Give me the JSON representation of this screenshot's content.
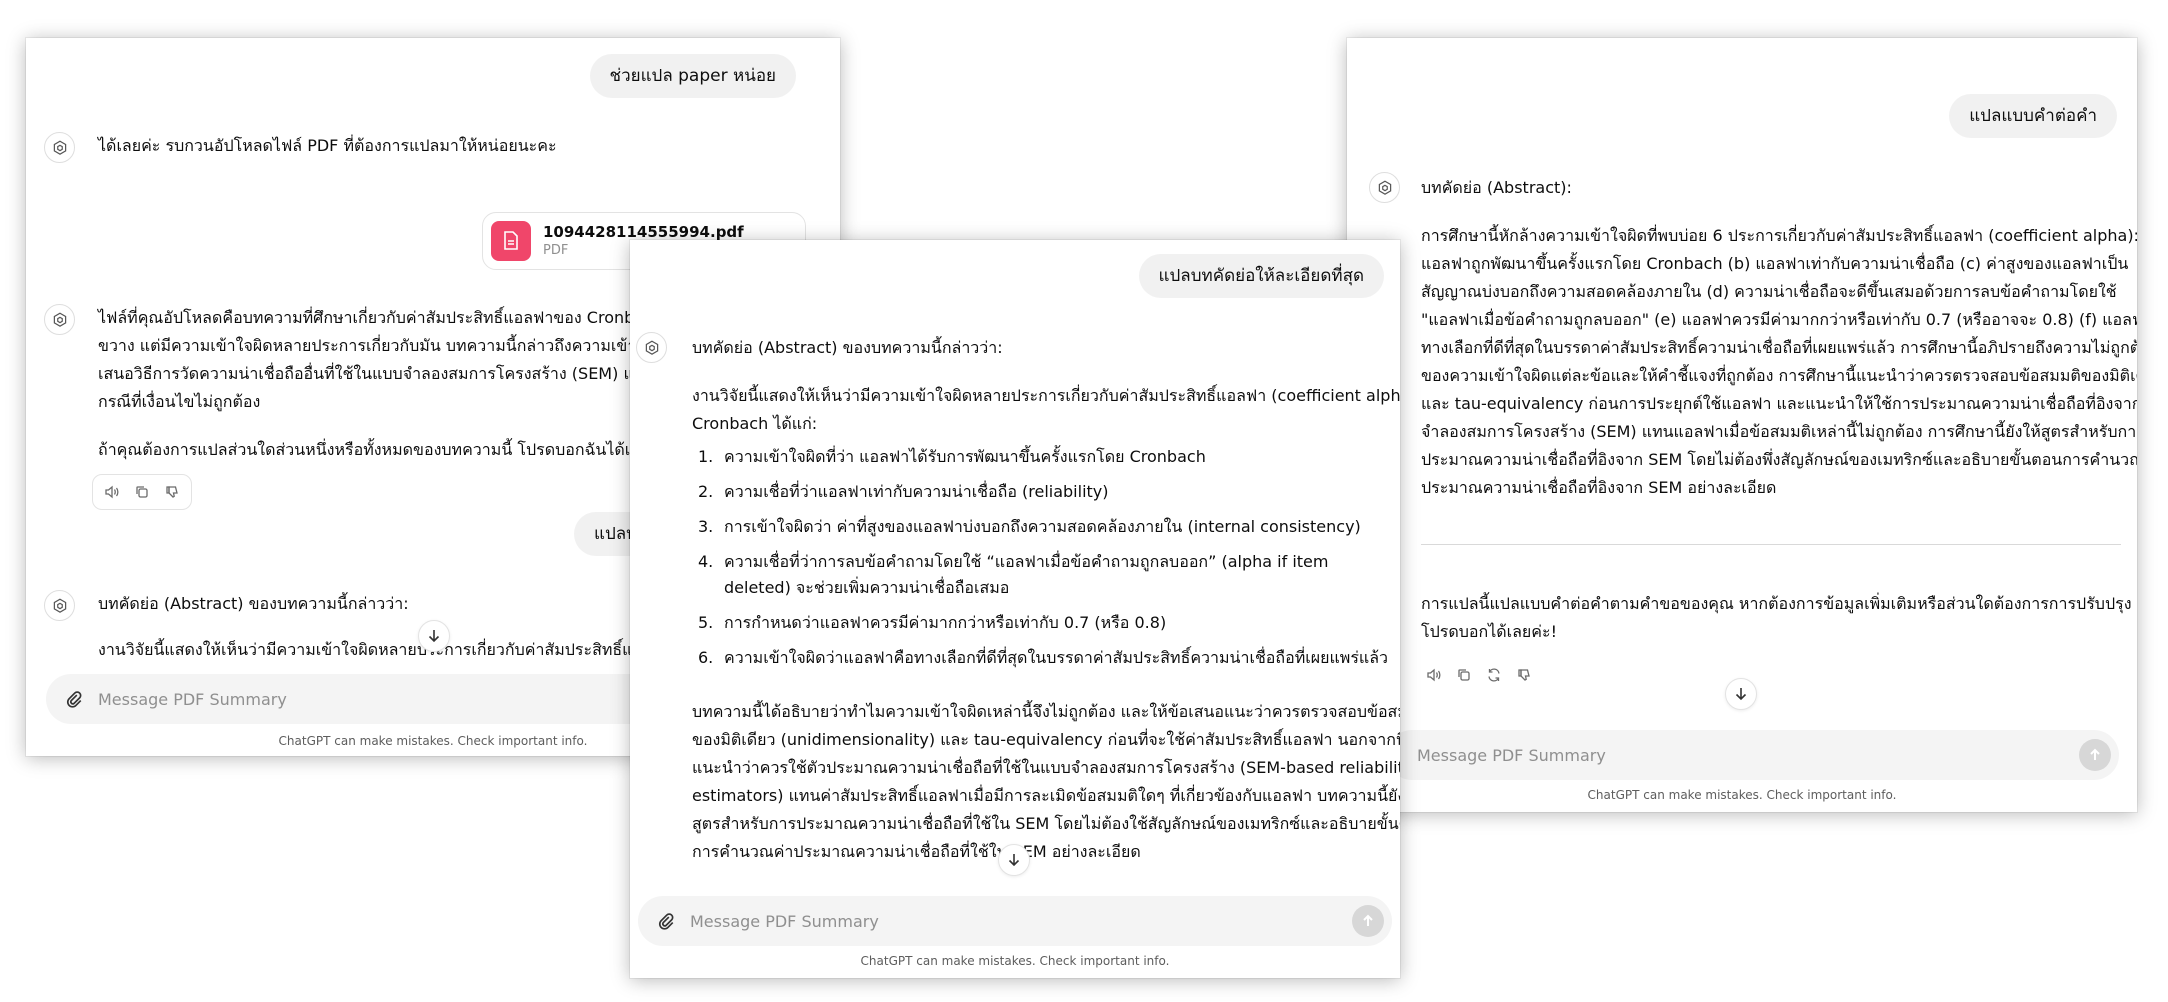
{
  "left_window": {
    "user_msg_1": "ช่วยแปล paper หน่อย",
    "assistant_msg_1": "ได้เลยค่ะ รบกวนอัปโหลดไฟล์ PDF ที่ต้องการแปลมาให้หน่อยนะคะ",
    "file": {
      "name": "1094428114555994.pdf",
      "type": "PDF"
    },
    "assistant_msg_2_lines": [
      "ไฟล์ที่คุณอัปโหลดคือบทความที่ศึกษาเกี่ยวกับค่าสัมประสิทธิ์แอลฟาของ Cronbach",
      "ขวาง แต่มีความเข้าใจผิดหลายประการเกี่ยวกับมัน บทความนี้กล่าวถึงความเข้าใจผิด",
      "เสนอวิธีการวัดความน่าเชื่อถืออื่นที่ใช้ในแบบจำลองสมการโครงสร้าง (SEM) แทนค่า",
      "กรณีที่เงื่อนไขไม่ถูกต้อง"
    ],
    "assistant_msg_3": "ถ้าคุณต้องการแปลส่วนใดส่วนหนึ่งหรือทั้งหมดของบทความนี้ โปรดบอกฉันได้เลยค่ะ",
    "user_msg_2_partial": "แปลบ",
    "assistant_msg_4": "บทคัดย่อ (Abstract) ของบทความนี้กล่าวว่า:",
    "assistant_msg_5_partial": "งานวิจัยนี้แสดงให้เห็นว่ามีความเข้าใจผิดหลายประการเกี่ยวกับค่าสัมประสิทธิ์แอลฟา",
    "composer_placeholder": "Message PDF Summary",
    "disclaimer": "ChatGPT can make mistakes. Check important info."
  },
  "center_window": {
    "user_msg": "แปลบทคัดย่อให้ละเอียดที่สุด",
    "assistant_intro": "บทคัดย่อ (Abstract) ของบทความนี้กล่าวว่า:",
    "para1_lines": [
      "งานวิจัยนี้แสดงให้เห็นว่ามีความเข้าใจผิดหลายประการเกี่ยวกับค่าสัมประสิทธิ์แอลฟา (coefficient alpha) ของ",
      "Cronbach ได้แก่:"
    ],
    "list": [
      {
        "n": "1.",
        "text": "ความเข้าใจผิดที่ว่า แอลฟาได้รับการพัฒนาขึ้นครั้งแรกโดย Cronbach"
      },
      {
        "n": "2.",
        "text": "ความเชื่อที่ว่าแอลฟาเท่ากับความน่าเชื่อถือ (reliability)"
      },
      {
        "n": "3.",
        "text": "การเข้าใจผิดว่า ค่าที่สูงของแอลฟาบ่งบอกถึงความสอดคล้องภายใน (internal consistency)"
      },
      {
        "n": "4.",
        "text": "ความเชื่อที่ว่าการลบข้อคำถามโดยใช้ “แอลฟาเมื่อข้อคำถามถูกลบออก” (alpha if item deleted) จะช่วยเพิ่มความน่าเชื่อถือเสมอ"
      },
      {
        "n": "5.",
        "text": "การกำหนดว่าแอลฟาควรมีค่ามากกว่าหรือเท่ากับ 0.7 (หรือ 0.8)"
      },
      {
        "n": "6.",
        "text": "ความเข้าใจผิดว่าแอลฟาคือทางเลือกที่ดีที่สุดในบรรดาค่าสัมประสิทธิ์ความน่าเชื่อถือที่เผยแพร่แล้ว"
      }
    ],
    "para2_lines": [
      "บทความนี้ได้อธิบายว่าทำไมความเข้าใจผิดเหล่านี้จึงไม่ถูกต้อง และให้ข้อเสนอแนะว่าควรตรวจสอบข้อสมมติ",
      "ของมิติเดียว (unidimensionality) และ tau-equivalency ก่อนที่จะใช้ค่าสัมประสิทธิ์แอลฟา นอกจากนี้ยัง",
      "แนะนำว่าควรใช้ตัวประมาณความน่าเชื่อถือที่ใช้ในแบบจำลองสมการโครงสร้าง (SEM-based reliability",
      "estimators) แทนค่าสัมประสิทธิ์แอลฟาเมื่อมีการละเมิดข้อสมมติใดๆ ที่เกี่ยวข้องกับแอลฟา บทความนี้ยังให้",
      "สูตรสำหรับการประมาณความน่าเชื่อถือที่ใช้ใน SEM โดยไม่ต้องใช้สัญลักษณ์ของเมทริกซ์และอธิบายขั้นตอน",
      "การคำนวณค่าประมาณความน่าเชื่อถือที่ใช้ใน SEM อย่างละเอียด"
    ],
    "composer_placeholder": "Message PDF Summary",
    "disclaimer": "ChatGPT can make mistakes. Check important info."
  },
  "right_window": {
    "user_msg": "แปลแบบคำต่อคำ",
    "assistant_heading": "บทคัดย่อ (Abstract):",
    "body_lines": [
      "การศึกษานี้หักล้างความเข้าใจผิดที่พบบ่อย 6 ประการเกี่ยวกับค่าสัมประสิทธิ์แอลฟา (coefficient alpha): (a)",
      "แอลฟาถูกพัฒนาขึ้นครั้งแรกโดย Cronbach (b) แอลฟาเท่ากับความน่าเชื่อถือ (c) ค่าสูงของแอลฟาเป็น",
      "สัญญาณบ่งบอกถึงความสอดคล้องภายใน (d) ความน่าเชื่อถือจะดีขึ้นเสมอด้วยการลบข้อคำถามโดยใช้",
      "\"แอลฟาเมื่อข้อคำถามถูกลบออก\" (e) แอลฟาควรมีค่ามากกว่าหรือเท่ากับ 0.7 (หรืออาจจะ 0.8) (f) แอลฟาคือ",
      "ทางเลือกที่ดีที่สุดในบรรดาค่าสัมประสิทธิ์ความน่าเชื่อถือที่เผยแพร่แล้ว การศึกษานี้อภิปรายถึงความไม่ถูกต้อง",
      "ของความเข้าใจผิดแต่ละข้อและให้คำชี้แจงที่ถูกต้อง การศึกษานี้แนะนำว่าควรตรวจสอบข้อสมมติของมิติเดียว",
      "และ tau-equivalency ก่อนการประยุกต์ใช้แอลฟา และแนะนำให้ใช้การประมาณความน่าเชื่อถือที่อิงจากแบบ",
      "จำลองสมการโครงสร้าง (SEM) แทนแอลฟาเมื่อข้อสมมติเหล่านี้ไม่ถูกต้อง การศึกษานี้ยังให้สูตรสำหรับการ",
      "ประมาณความน่าเชื่อถือที่อิงจาก SEM โดยไม่ต้องพึ่งสัญลักษณ์ของเมทริกซ์และอธิบายขั้นตอนการคำนวณค่า",
      "ประมาณความน่าเชื่อถือที่อิงจาก SEM อย่างละเอียด"
    ],
    "closing_lines": [
      "การแปลนี้แปลแบบคำต่อคำตามคำขอของคุณ หากต้องการข้อมูลเพิ่มเติมหรือส่วนใดต้องการการปรับปรุง",
      "โปรดบอกได้เลยค่ะ!"
    ],
    "composer_placeholder": "Message PDF Summary",
    "disclaimer": "ChatGPT can make mistakes. Check important info."
  }
}
